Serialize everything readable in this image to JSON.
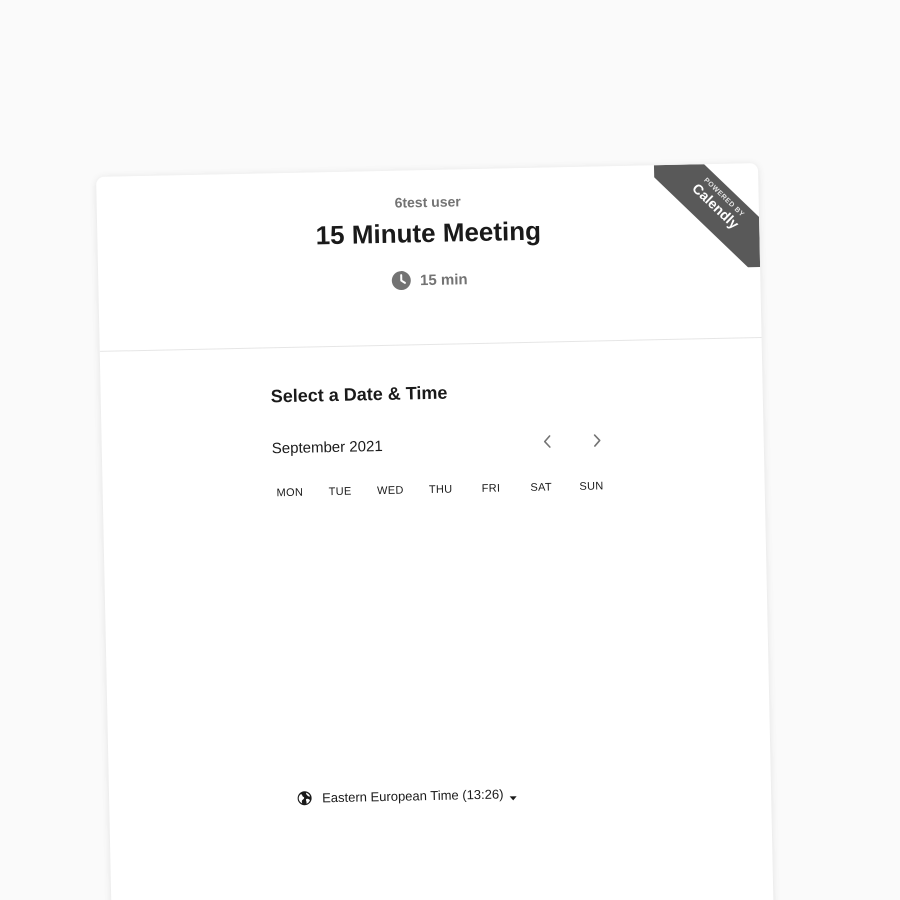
{
  "event": {
    "owner": "6test user",
    "title": "15 Minute Meeting",
    "duration_label": "15 min",
    "duration_icon": "clock-icon"
  },
  "badge": {
    "small_text": "POWERED BY",
    "brand": "Calendly",
    "background": "#595959"
  },
  "calendar": {
    "section_title": "Select a Date & Time",
    "month_label": "September 2021",
    "prev_icon": "chevron-left-icon",
    "next_icon": "chevron-right-icon",
    "weekdays": [
      "MON",
      "TUE",
      "WED",
      "THU",
      "FRI",
      "SAT",
      "SUN"
    ]
  },
  "timezone": {
    "icon": "globe-icon",
    "label": "Eastern European Time (13:26)",
    "dropdown_icon": "caret-down-icon"
  },
  "colors": {
    "page_background": "#fafafa",
    "card_background": "#ffffff",
    "text_primary": "#1a1a1a",
    "text_secondary": "#737373"
  }
}
